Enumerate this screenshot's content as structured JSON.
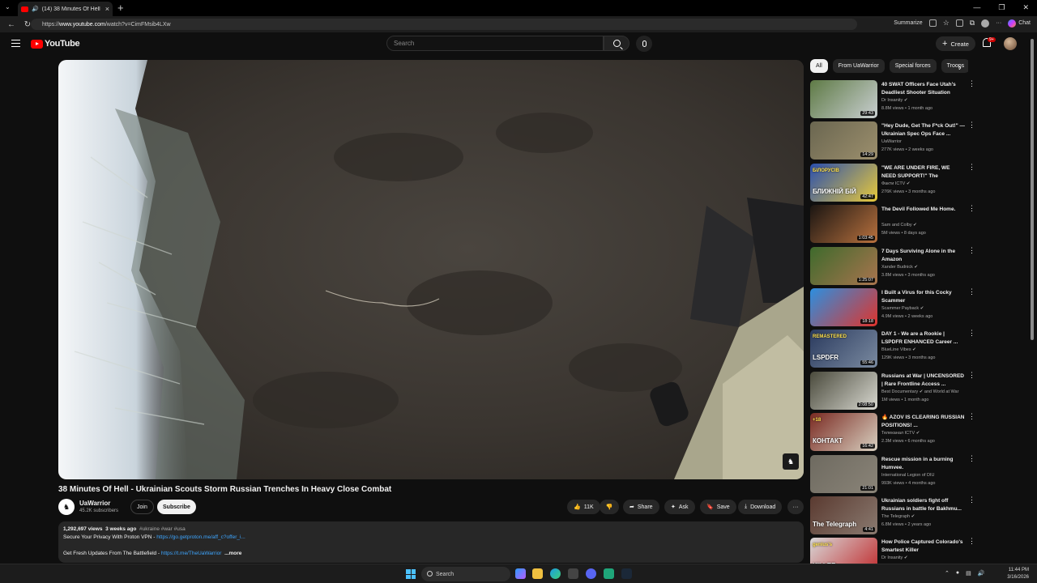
{
  "browser": {
    "tab_title": "(14) 38 Minutes Of Hell - Ukr",
    "url_prefix": "https://",
    "url_host": "www.youtube.com",
    "url_path": "/watch?v=CimFMsib4LXw",
    "summarize_label": "Summarize",
    "chat_label": "Chat"
  },
  "masthead": {
    "logo_text": "YouTube",
    "search_placeholder": "Search",
    "create_label": "Create",
    "notif_badge": "9+"
  },
  "video": {
    "title": "38 Minutes Of Hell - Ukrainian Scouts Storm Russian Trenches In Heavy Close Combat",
    "channel_name": "UaWarrior",
    "subscribers": "45.2K subscribers",
    "join_label": "Join",
    "subscribe_label": "Subscribe",
    "likes": "11K",
    "share_label": "Share",
    "ask_label": "Ask",
    "save_label": "Save",
    "download_label": "Download"
  },
  "description": {
    "views": "1,292,697 views",
    "age": "3 weeks ago",
    "tags": "#ukraine #war #usa",
    "line1_text": "Secure Your Privacy With Proton VPN - ",
    "line1_link": "https://go.getproton.me/aff_c?offer_i...",
    "line2_text": "Get Fresh Updates From The Battlefield - ",
    "line2_link": "https://t.me/TheUaWarrior",
    "more_label": "...more"
  },
  "chips": [
    "All",
    "From UaWarrior",
    "Special forces",
    "Troops"
  ],
  "recommendations": [
    {
      "title": "40 SWAT Officers Face Utah's Deadliest Shooter Situation",
      "channel": "Dr Insanity",
      "verified": true,
      "meta": "8.8M views • 1 month ago",
      "duration": "29:43",
      "colors": [
        "#5e7a45",
        "#c9cfd1"
      ]
    },
    {
      "title": "\"Hey Dude, Get The F*ck Out!\" — Ukrainian Spec Ops Face ...",
      "channel": "UaWarrior",
      "verified": false,
      "meta": "277K views • 2 weeks ago",
      "duration": "14:29",
      "colors": [
        "#6a6650",
        "#9c8f6d"
      ]
    },
    {
      "title": "\"WE ARE UNDER FIRE, WE NEED SUPPORT!\" The Belarusians ...",
      "channel": "Факти ICTV",
      "verified": true,
      "meta": "276K views • 3 months ago",
      "duration": "42:47",
      "colors": [
        "#2a4fae",
        "#e8c93a"
      ],
      "overlay": "БЛИЖНІЙ БІЙ",
      "overlay2": "БІЛОРУСІВ"
    },
    {
      "title": "The Devil Followed Me Home.",
      "channel": "Sam and Colby",
      "verified": true,
      "meta": "5M views • 8 days ago",
      "duration": "1:03:45",
      "colors": [
        "#1a1512",
        "#b8713e"
      ]
    },
    {
      "title": "7 Days Surviving Alone in the Amazon",
      "channel": "Xander Budnick",
      "verified": true,
      "meta": "3.8M views • 3 months ago",
      "duration": "1:25:07",
      "colors": [
        "#3e6a2c",
        "#a9744e"
      ]
    },
    {
      "title": "I Built a Virus for this Cocky Scammer",
      "channel": "Scammer Payback",
      "verified": true,
      "meta": "4.9M views • 2 weeks ago",
      "duration": "18:18",
      "colors": [
        "#2c8fe0",
        "#e0342c"
      ]
    },
    {
      "title": "DAY 1 - We are a Rookie | LSPDFR ENHANCED Career ...",
      "channel": "BlueLine Vibes",
      "verified": true,
      "meta": "129K views • 3 months ago",
      "duration": "55:46",
      "colors": [
        "#2a3a5e",
        "#7a8aa0"
      ],
      "overlay": "LSPDFR",
      "overlay2": "REMASTERED"
    },
    {
      "title": "Russians at War | UNCENSORED | Rare Frontline Access ...",
      "channel": "Best Documentary",
      "verified": true,
      "channel2": "and World at War",
      "meta": "1M views • 1 month ago",
      "duration": "2:08:50",
      "colors": [
        "#4a4a3c",
        "#d8d8d0"
      ]
    },
    {
      "title": "🔥 AZOV IS CLEARING RUSSIAN POSITIONS! ...",
      "channel": "Телеканал ICTV",
      "verified": true,
      "meta": "2.3M views • 6 months ago",
      "duration": "16:42",
      "colors": [
        "#7a2a22",
        "#d8d0c0"
      ],
      "overlay": "КОНТАКТ",
      "overlay2": "+18"
    },
    {
      "title": "Rescue mission in a burning Humvee.",
      "channel": "International Legion of DIU",
      "verified": false,
      "meta": "993K views • 4 months ago",
      "duration": "21:01",
      "colors": [
        "#6e6a60",
        "#8a8478"
      ]
    },
    {
      "title": "Ukrainian soldiers fight off Russians in battle for Bakhmu...",
      "channel": "The Telegraph",
      "verified": true,
      "meta": "6.8M views • 2 years ago",
      "duration": "4:41",
      "colors": [
        "#5a3a30",
        "#8a7a70"
      ],
      "overlay": "The Telegraph"
    },
    {
      "title": "How Police Captured Colorado's Smartest Killer",
      "channel": "Dr Insanity",
      "verified": true,
      "meta": "",
      "duration": "",
      "colors": [
        "#d8d8d8",
        "#c0282a"
      ],
      "overlay": "KILLER",
      "overlay2": "genius's"
    }
  ],
  "taskbar": {
    "search_label": "Search",
    "time": "11:44 PM",
    "date": "3/16/2026"
  }
}
